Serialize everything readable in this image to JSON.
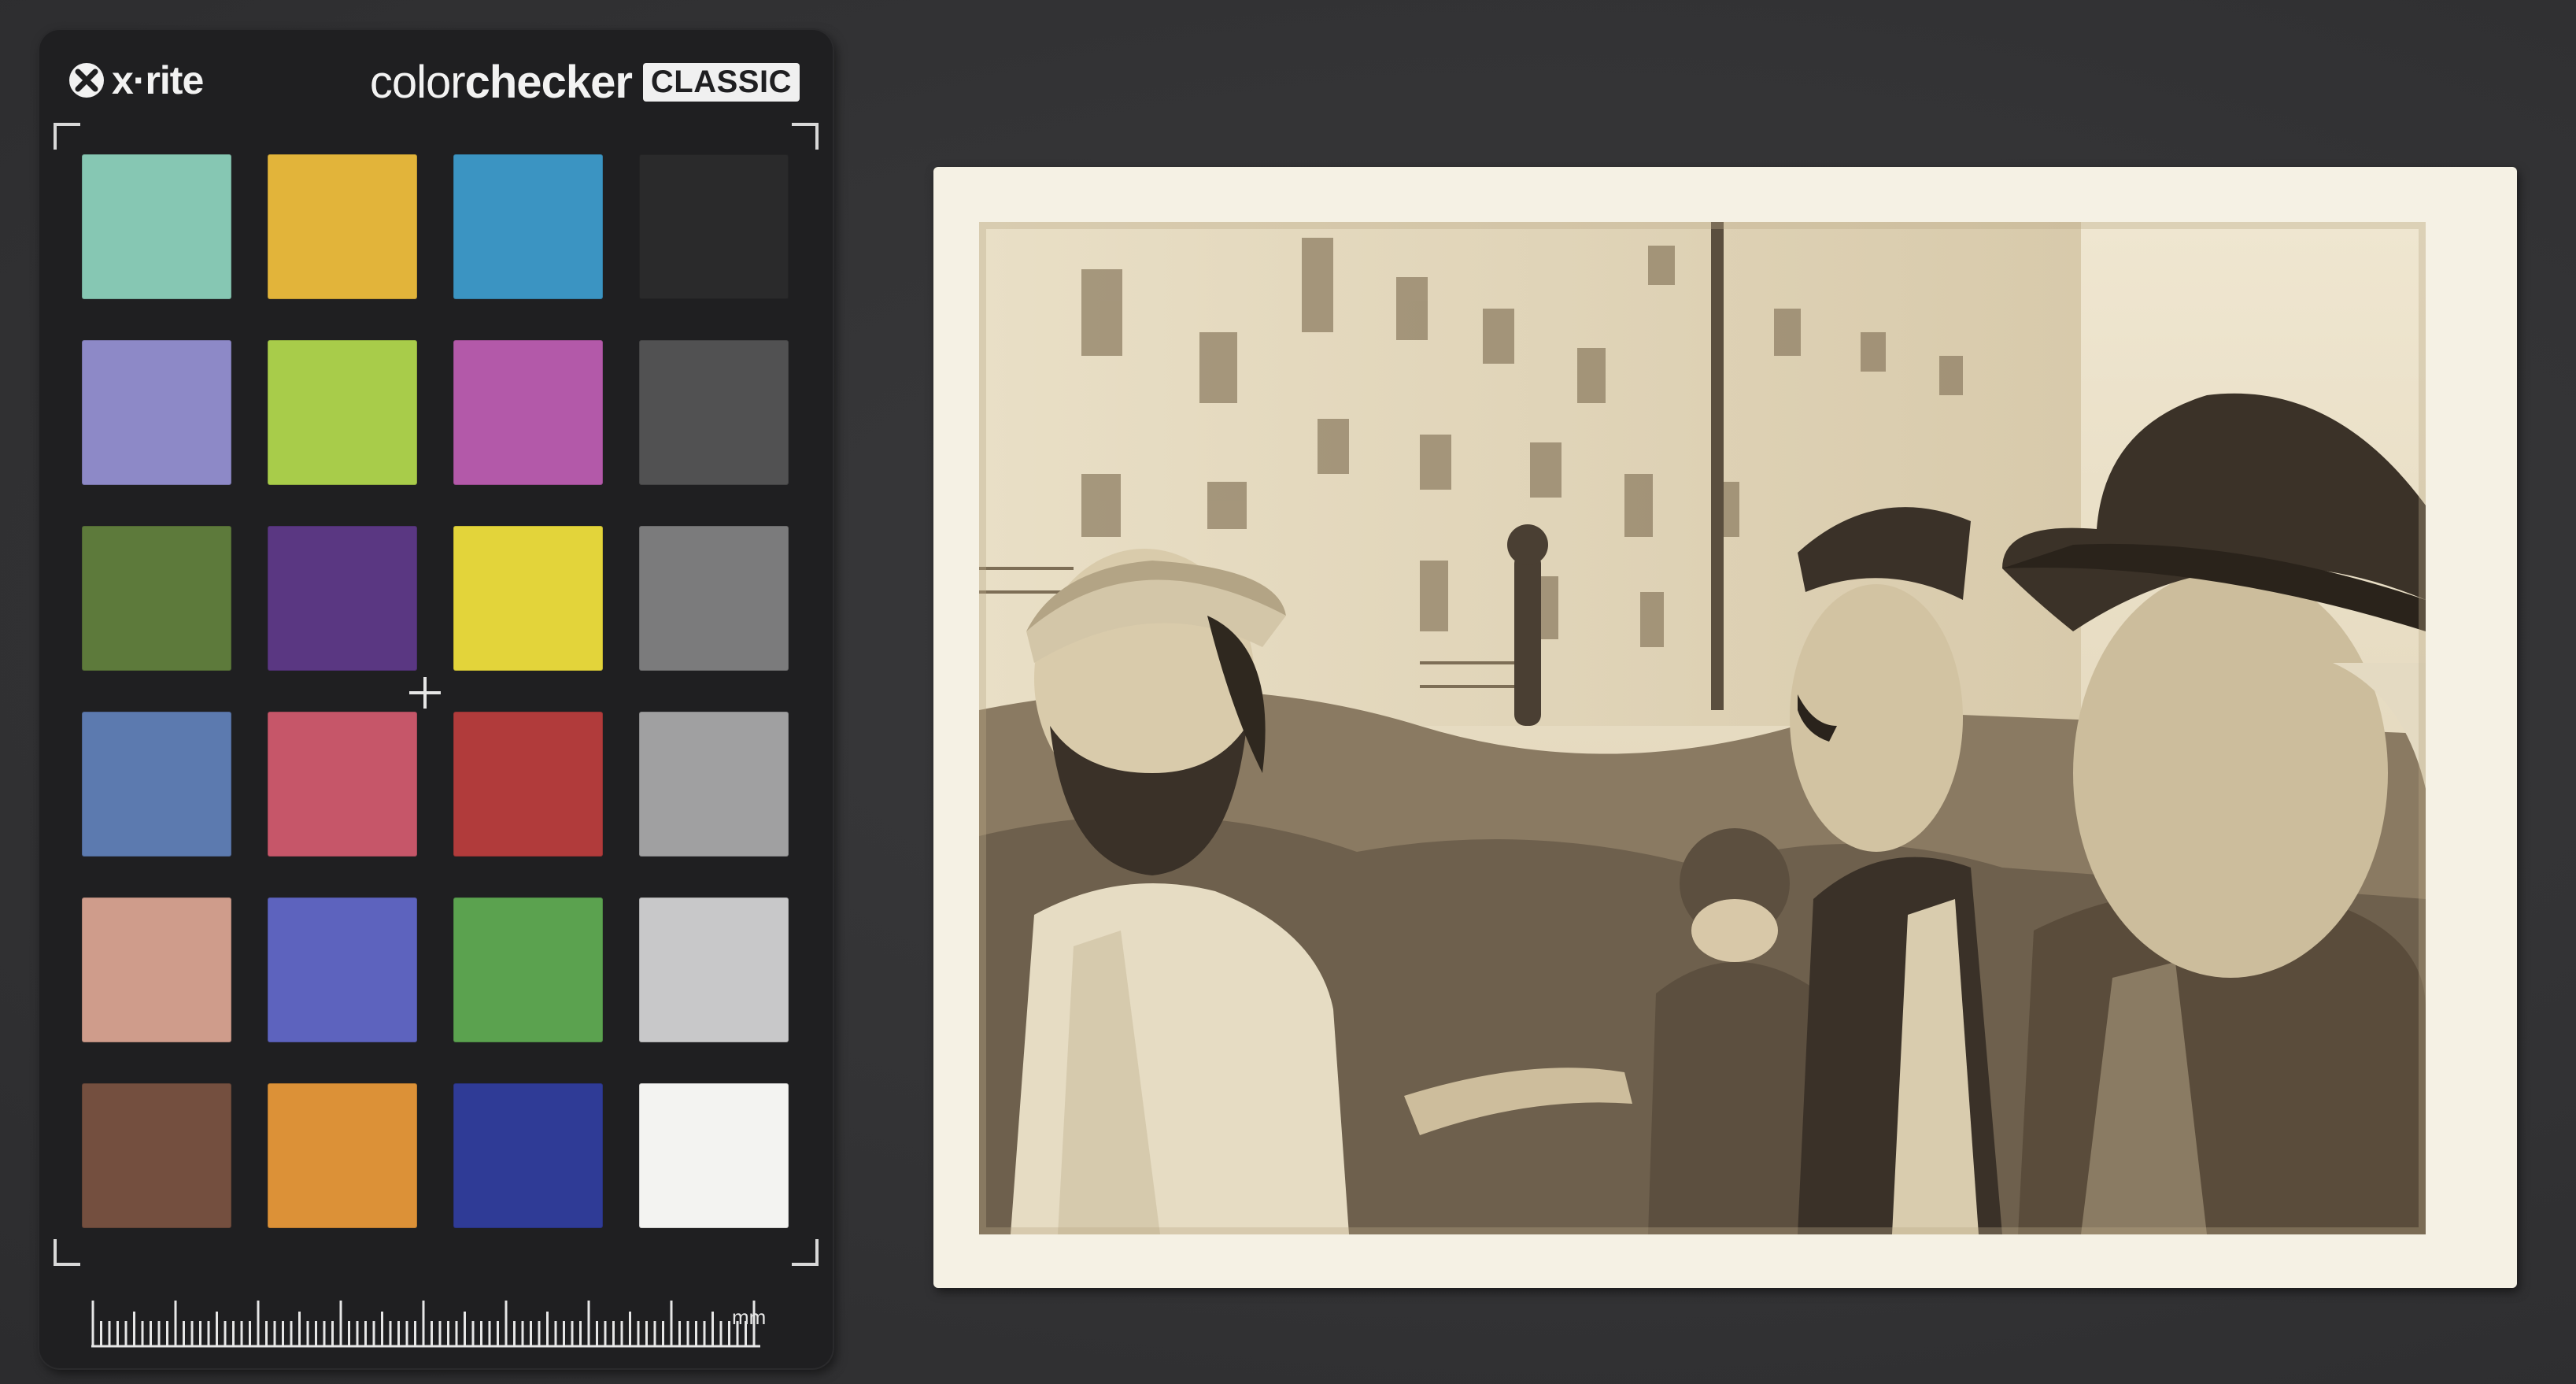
{
  "color_checker": {
    "brand": "x·rite",
    "product_prefix": "color",
    "product_bold": "checker",
    "product_badge": "CLASSIC",
    "ruler_unit": "mm",
    "patches": [
      [
        "#86c7b3",
        "#e2b43a",
        "#3b94c2",
        "#2a2a2b"
      ],
      [
        "#8d89c7",
        "#a8cc4a",
        "#b359a9",
        "#515152"
      ],
      [
        "#5d7a3b",
        "#5a3782",
        "#e3d43a",
        "#7b7b7c"
      ],
      [
        "#5c7aaf",
        "#c65669",
        "#b13b3b",
        "#a0a0a1"
      ],
      [
        "#cf9c8b",
        "#5d63be",
        "#5ba24f",
        "#c8c8c9"
      ],
      [
        "#744f3f",
        "#dc9137",
        "#2f3b96",
        "#f3f3f1"
      ]
    ]
  },
  "photograph": {
    "style": "sepia-toned black-and-white print",
    "palette": {
      "paper": "#f5f1e4",
      "light": "#ece3cc",
      "mid": "#a8977a",
      "dark": "#4a3f33",
      "shadow": "#2e271f"
    }
  }
}
